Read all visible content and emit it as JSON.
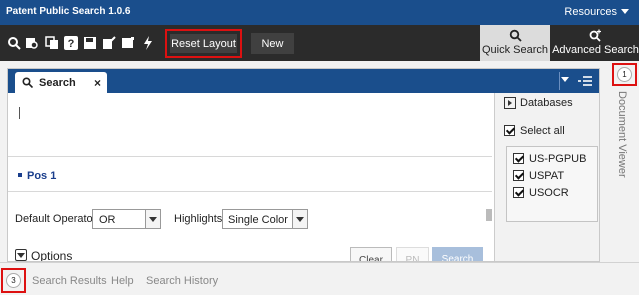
{
  "app": {
    "title": "Patent Public Search 1.0.6",
    "resources_label": "Resources"
  },
  "toolbar": {
    "icons": [
      "search-icon",
      "search-history-icon",
      "copy-icon",
      "help-icon",
      "save-icon",
      "edit-note-icon",
      "window-icon",
      "flash-icon"
    ],
    "reset_layout_label": "Reset Layout",
    "new_label": "New",
    "quick_search_label": "Quick Search",
    "advanced_search_label": "Advanced Search"
  },
  "search_panel": {
    "tab_label": "Search",
    "close_glyph": "×",
    "query_value": "",
    "position_label": "Pos 1",
    "default_operator_label": "Default Operator:",
    "default_operator_value": "OR",
    "highlights_label": "Highlights:",
    "highlights_value": "Single Color",
    "options_label": "Options",
    "clear_label": "Clear",
    "pn_label": "PN",
    "search_label": "Search"
  },
  "databases": {
    "header": "Databases",
    "select_all_label": "Select all",
    "items": [
      {
        "label": "US-PGPUB",
        "checked": true
      },
      {
        "label": "USPAT",
        "checked": true
      },
      {
        "label": "USOCR",
        "checked": true
      }
    ]
  },
  "document_viewer": {
    "label": "Document Viewer",
    "badge": "1"
  },
  "bottom_tabs": {
    "badge": "3",
    "items": [
      "Search Results",
      "Help",
      "Search History"
    ]
  },
  "colors": {
    "header_blue": "#1a4e8c",
    "toolbar_dark": "#2b2b2b",
    "highlight_red": "#dd1111"
  }
}
